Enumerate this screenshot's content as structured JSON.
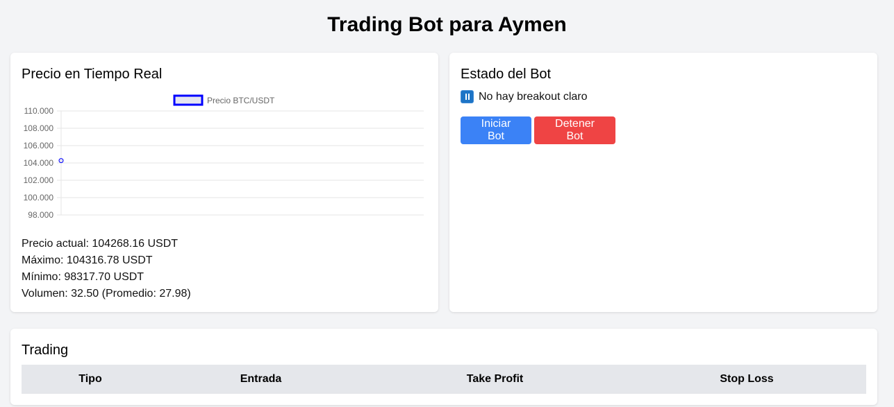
{
  "header": {
    "title": "Trading Bot para Aymen"
  },
  "price_card": {
    "title": "Precio en Tiempo Real",
    "stats": {
      "current": "Precio actual: 104268.16 USDT",
      "max": "Máximo: 104316.78 USDT",
      "min": "Mínimo: 98317.70 USDT",
      "volume": "Volumen: 32.50 (Promedio: 27.98)"
    }
  },
  "chart_data": {
    "type": "line",
    "series": [
      {
        "name": "Precio BTC/USDT",
        "x": [
          0
        ],
        "values": [
          104268.16
        ],
        "color": "#0000ff"
      }
    ],
    "y_ticks": [
      "110.000",
      "108.000",
      "106.000",
      "104.000",
      "102.000",
      "100.000",
      "98.000"
    ],
    "ylim": [
      98000,
      110000
    ],
    "legend_position": "top",
    "grid": true
  },
  "status_card": {
    "title": "Estado del Bot",
    "icon": "pause-icon",
    "status_text": "No hay breakout claro",
    "start_label": "Iniciar Bot",
    "stop_label": "Detener Bot"
  },
  "trading_card": {
    "title": "Trading",
    "columns": [
      "Tipo",
      "Entrada",
      "Take Profit",
      "Stop Loss"
    ]
  }
}
